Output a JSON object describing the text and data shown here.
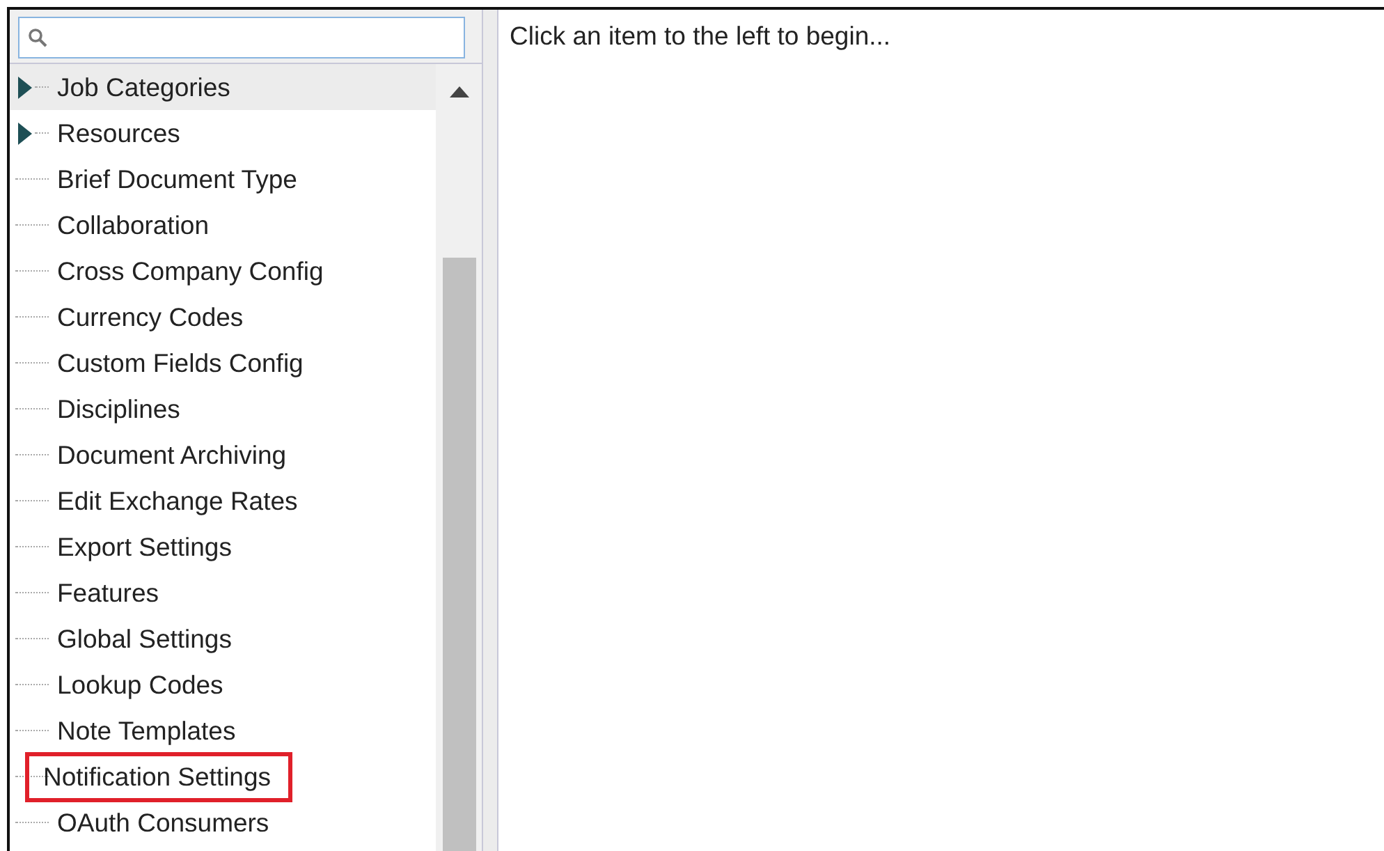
{
  "tree": {
    "items": [
      {
        "label": "Job Categories",
        "kind": "branch",
        "expanded": false,
        "selected": true,
        "annotated": false
      },
      {
        "label": "Resources",
        "kind": "branch",
        "expanded": false,
        "selected": false,
        "annotated": false
      },
      {
        "label": "Brief Document Type",
        "kind": "leaf",
        "selected": false,
        "annotated": false
      },
      {
        "label": "Collaboration",
        "kind": "leaf",
        "selected": false,
        "annotated": false
      },
      {
        "label": "Cross Company Config",
        "kind": "leaf",
        "selected": false,
        "annotated": false
      },
      {
        "label": "Currency Codes",
        "kind": "leaf",
        "selected": false,
        "annotated": false
      },
      {
        "label": "Custom Fields Config",
        "kind": "leaf",
        "selected": false,
        "annotated": false
      },
      {
        "label": "Disciplines",
        "kind": "leaf",
        "selected": false,
        "annotated": false
      },
      {
        "label": "Document Archiving",
        "kind": "leaf",
        "selected": false,
        "annotated": false
      },
      {
        "label": "Edit Exchange Rates",
        "kind": "leaf",
        "selected": false,
        "annotated": false
      },
      {
        "label": "Export Settings",
        "kind": "leaf",
        "selected": false,
        "annotated": false
      },
      {
        "label": "Features",
        "kind": "leaf",
        "selected": false,
        "annotated": false
      },
      {
        "label": "Global Settings",
        "kind": "leaf",
        "selected": false,
        "annotated": false
      },
      {
        "label": "Lookup Codes",
        "kind": "leaf",
        "selected": false,
        "annotated": false
      },
      {
        "label": "Note Templates",
        "kind": "leaf",
        "selected": false,
        "annotated": false
      },
      {
        "label": "Notification Settings",
        "kind": "leaf",
        "selected": false,
        "annotated": true
      },
      {
        "label": "OAuth Consumers",
        "kind": "leaf",
        "selected": false,
        "annotated": false
      }
    ]
  },
  "content": {
    "message": "Click an item to the left to begin..."
  }
}
